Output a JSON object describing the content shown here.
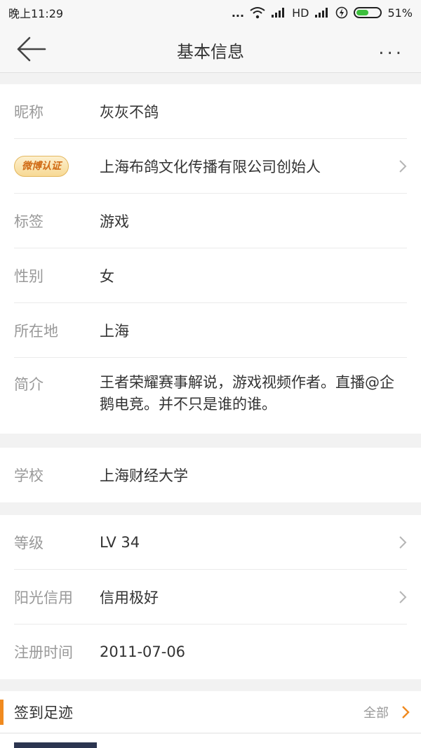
{
  "status_bar": {
    "time": "晚上11:29",
    "signal_dots": "...",
    "network": "HD",
    "battery_percent": "51%",
    "battery_level": 0.51
  },
  "nav": {
    "title": "基本信息",
    "more": "..."
  },
  "basic": [
    {
      "label": "昵称",
      "value": "灰灰不鸽"
    },
    {
      "label_badge": "微博认证",
      "value": "上海布鸽文化传播有限公司创始人"
    },
    {
      "label": "标签",
      "value": "游戏"
    },
    {
      "label": "性别",
      "value": "女"
    },
    {
      "label": "所在地",
      "value": "上海"
    },
    {
      "label": "简介",
      "value": "王者荣耀赛事解说，游戏视频作者。直播@企鹅电竞。并不只是谁的谁。"
    }
  ],
  "school": {
    "label": "学校",
    "value": "上海财经大学"
  },
  "account": [
    {
      "label": "等级",
      "value": "LV 34"
    },
    {
      "label": "阳光信用",
      "value": "信用极好"
    },
    {
      "label": "注册时间",
      "value": "2011-07-06"
    }
  ],
  "checkin": {
    "title": "签到足迹",
    "all_label": "全部"
  },
  "colors": {
    "accent": "#f08a1f",
    "battery": "#3cbf3c"
  }
}
